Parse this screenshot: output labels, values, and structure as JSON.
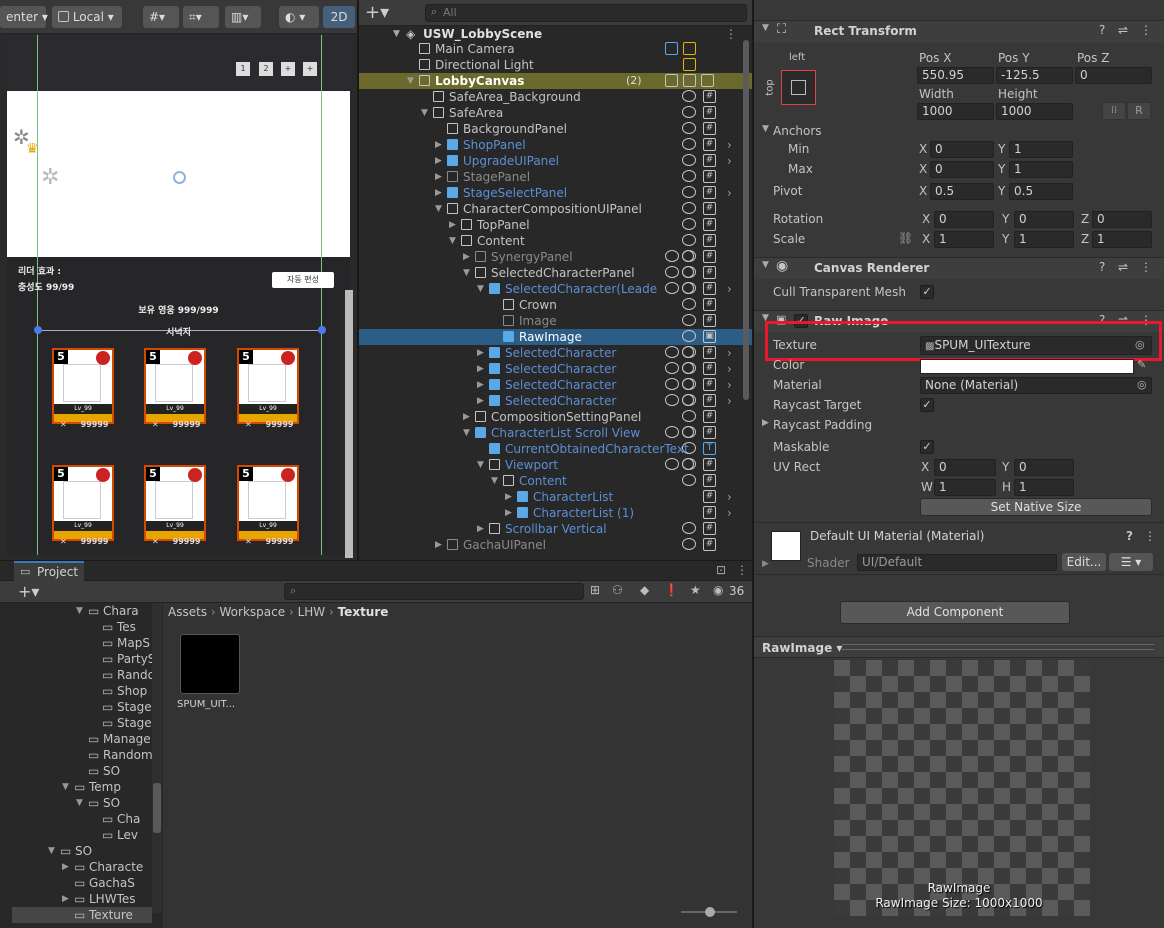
{
  "scene_toolbar": {
    "pivot_label": "enter",
    "space_label": "Local",
    "mode_2d": "2D"
  },
  "game_view": {
    "page_buttons": [
      "1",
      "2",
      "+",
      "+"
    ],
    "leader_effect": "리더 효과 :",
    "loyalty": "충성도 99/99",
    "auto_button": "자동 편성",
    "owned_heroes": "보유 영웅 999/999",
    "start_label": "시넉지",
    "card_level": "5",
    "card_name": "Lv_99",
    "card_power": "99999"
  },
  "hierarchy": {
    "search_placeholder": "All",
    "scene_name": "USW_LobbyScene",
    "rows": [
      {
        "label": "Main Camera"
      },
      {
        "label": "Directional Light"
      },
      {
        "label": "LobbyCanvas",
        "badge": "(2)"
      },
      {
        "label": "SafeArea_Background"
      },
      {
        "label": "SafeArea"
      },
      {
        "label": "BackgroundPanel"
      },
      {
        "label": "ShopPanel"
      },
      {
        "label": "UpgradeUIPanel"
      },
      {
        "label": "StagePanel"
      },
      {
        "label": "StageSelectPanel"
      },
      {
        "label": "CharacterCompositionUIPanel"
      },
      {
        "label": "TopPanel"
      },
      {
        "label": "Content"
      },
      {
        "label": "SynergyPanel"
      },
      {
        "label": "SelectedCharacterPanel"
      },
      {
        "label": "SelectedCharacter(Leade"
      },
      {
        "label": "Crown"
      },
      {
        "label": "Image"
      },
      {
        "label": "RawImage"
      },
      {
        "label": "SelectedCharacter"
      },
      {
        "label": "SelectedCharacter"
      },
      {
        "label": "SelectedCharacter"
      },
      {
        "label": "SelectedCharacter"
      },
      {
        "label": "CompositionSettingPanel"
      },
      {
        "label": "CharacterList Scroll View"
      },
      {
        "label": "CurrentObtainedCharacterText"
      },
      {
        "label": "Viewport"
      },
      {
        "label": "Content"
      },
      {
        "label": "CharacterList"
      },
      {
        "label": "CharacterList (1)"
      },
      {
        "label": "Scrollbar Vertical"
      },
      {
        "label": "GachaUIPanel"
      }
    ]
  },
  "project": {
    "tab": "Project",
    "breadcrumb": [
      "Assets",
      "Workspace",
      "LHW",
      "Texture"
    ],
    "hidden_count": "36",
    "tree": [
      "Chara",
      "Tes",
      "MapS",
      "PartyS",
      "Rando",
      "Shop",
      "Stage",
      "Stage",
      "Manage",
      "Random",
      "SO",
      "Temp",
      "SO",
      "Cha",
      "Lev",
      "SO",
      "Characte",
      "GachaS",
      "LHWTes",
      "Texture"
    ],
    "asset_name": "SPUM_UIT..."
  },
  "inspector": {
    "rect_transform": {
      "title": "Rect Transform",
      "anchor_h": "left",
      "anchor_v": "top",
      "pos_x_label": "Pos X",
      "pos_y_label": "Pos Y",
      "pos_z_label": "Pos Z",
      "pos_x": "550.95",
      "pos_y": "-125.5",
      "pos_z": "0",
      "width_label": "Width",
      "height_label": "Height",
      "width": "1000",
      "height": "1000",
      "r_button": "R",
      "anchors_label": "Anchors",
      "min_label": "Min",
      "max_label": "Max",
      "min_x": "0",
      "min_y": "1",
      "max_x": "0",
      "max_y": "1",
      "pivot_label": "Pivot",
      "pivot_x": "0.5",
      "pivot_y": "0.5",
      "rotation_label": "Rotation",
      "rot_x": "0",
      "rot_y": "0",
      "rot_z": "0",
      "scale_label": "Scale",
      "scale_x": "1",
      "scale_y": "1",
      "scale_z": "1",
      "x": "X",
      "y": "Y",
      "z": "Z"
    },
    "canvas_renderer": {
      "title": "Canvas Renderer",
      "cull_label": "Cull Transparent Mesh"
    },
    "raw_image": {
      "title": "Raw Image",
      "texture_label": "Texture",
      "texture_value": "SPUM_UITexture",
      "color_label": "Color",
      "material_label": "Material",
      "material_value": "None (Material)",
      "raycast_target_label": "Raycast Target",
      "raycast_padding_label": "Raycast Padding",
      "maskable_label": "Maskable",
      "uv_rect_label": "UV Rect",
      "uv_x": "0",
      "uv_y": "0",
      "uv_w": "1",
      "uv_h": "1",
      "w": "W",
      "h": "H",
      "native_size_button": "Set Native Size"
    },
    "material": {
      "title": "Default UI Material (Material)",
      "shader_label": "Shader",
      "shader_value": "UI/Default",
      "edit_button": "Edit..."
    },
    "add_component": "Add Component",
    "preview": {
      "dropdown": "RawImage",
      "caption": "RawImage",
      "size": "RawImage Size: 1000x1000"
    },
    "highlight_color": "#e8192c"
  }
}
